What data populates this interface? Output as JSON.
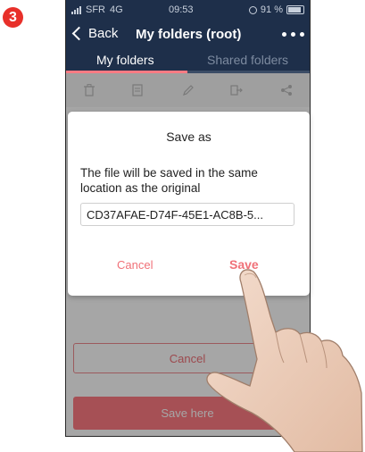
{
  "step_badge": "3",
  "status_bar": {
    "carrier": "SFR",
    "network": "4G",
    "time": "09:53",
    "battery": "91 %"
  },
  "nav": {
    "back_label": "Back",
    "title": "My folders (root)",
    "more_icon": "more-dots-icon"
  },
  "tabs": [
    {
      "label": "My folders",
      "active": true
    },
    {
      "label": "Shared folders",
      "active": false
    }
  ],
  "toolbar_icons": [
    "trash-icon",
    "document-icon",
    "pencil-icon",
    "move-icon",
    "share-icon"
  ],
  "dialog": {
    "title": "Save as",
    "message": "The file will be saved in the same location as the original",
    "filename": "CD37AFAE-D74F-45E1-AC8B-5...",
    "cancel_label": "Cancel",
    "save_label": "Save"
  },
  "sheet": {
    "cancel_label": "Cancel",
    "save_here_label": "Save here"
  },
  "colors": {
    "navbar": "#1e2f4a",
    "accent": "#ff7b83",
    "badge": "#e8302a"
  }
}
